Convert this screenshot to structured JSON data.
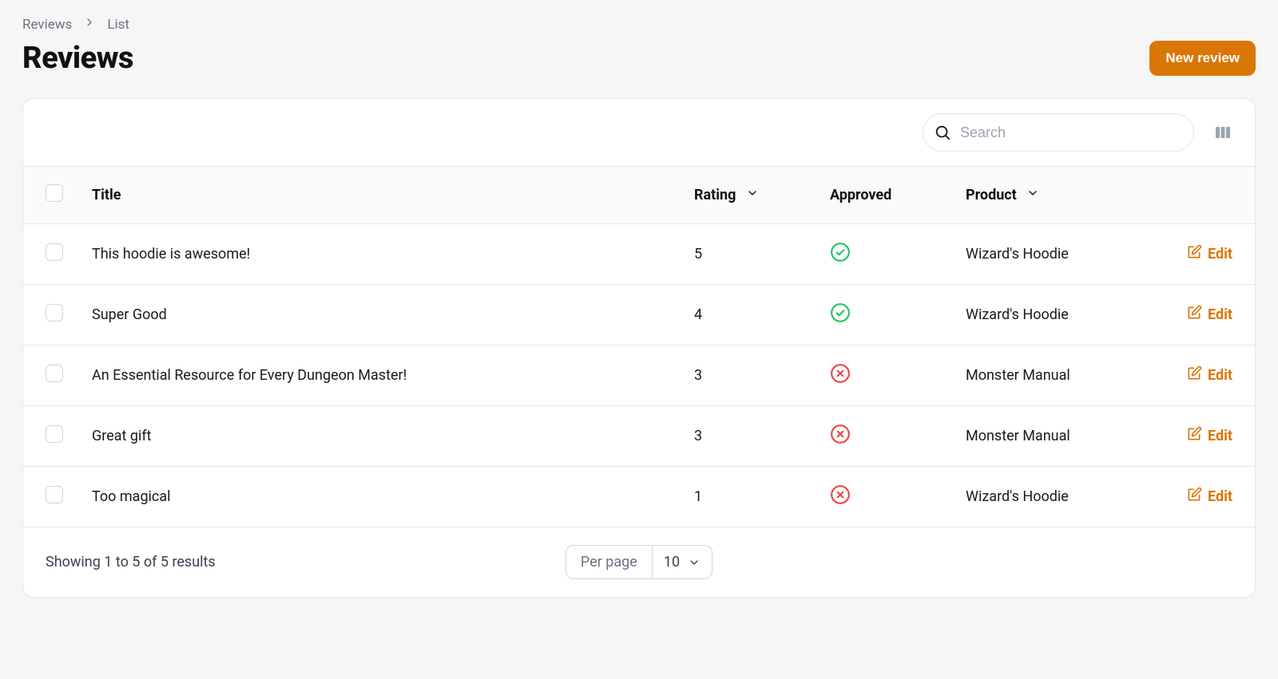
{
  "breadcrumb": {
    "root": "Reviews",
    "current": "List"
  },
  "page_title": "Reviews",
  "actions": {
    "new_review": "New review"
  },
  "toolbar": {
    "search_placeholder": "Search"
  },
  "table": {
    "columns": {
      "title": "Title",
      "rating": "Rating",
      "approved": "Approved",
      "product": "Product",
      "edit": "Edit"
    },
    "rows": [
      {
        "title": "This hoodie is awesome!",
        "rating": "5",
        "approved": true,
        "product": "Wizard's Hoodie"
      },
      {
        "title": "Super Good",
        "rating": "4",
        "approved": true,
        "product": "Wizard's Hoodie"
      },
      {
        "title": "An Essential Resource for Every Dungeon Master!",
        "rating": "3",
        "approved": false,
        "product": "Monster Manual"
      },
      {
        "title": "Great gift",
        "rating": "3",
        "approved": false,
        "product": "Monster Manual"
      },
      {
        "title": "Too magical",
        "rating": "1",
        "approved": false,
        "product": "Wizard's Hoodie"
      }
    ]
  },
  "pagination": {
    "summary": "Showing 1 to 5 of 5 results",
    "per_page_label": "Per page",
    "per_page_value": "10"
  }
}
